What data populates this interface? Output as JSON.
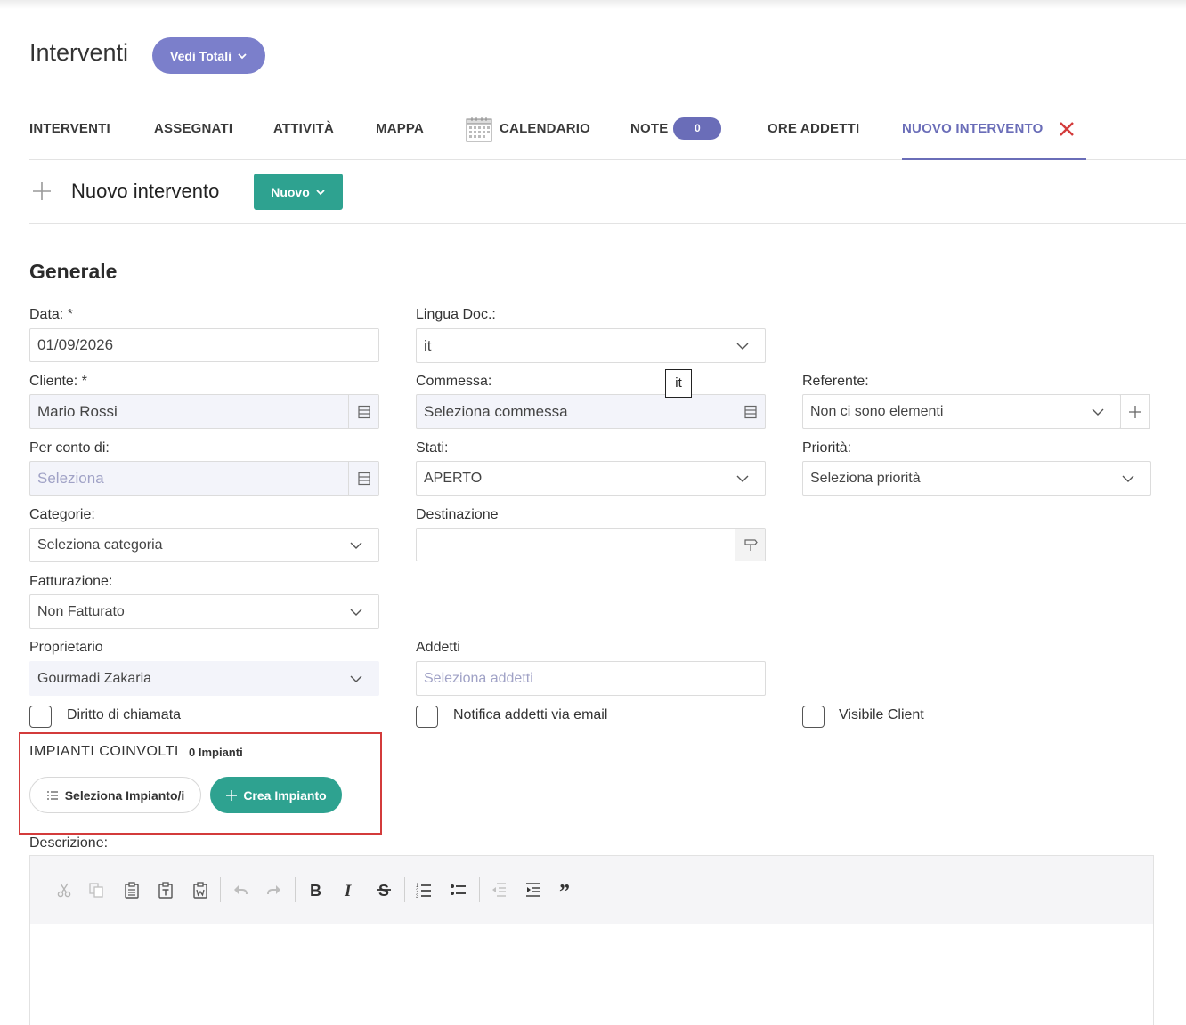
{
  "header": {
    "title": "Interventi",
    "totals_button": "Vedi Totali"
  },
  "tabs": [
    {
      "label": "INTERVENTI"
    },
    {
      "label": "ASSEGNATI"
    },
    {
      "label": "ATTIVITÀ"
    },
    {
      "label": "MAPPA"
    },
    {
      "label": "CALENDARIO"
    },
    {
      "label": "NOTE",
      "badge": "0"
    },
    {
      "label": "ORE ADDETTI"
    },
    {
      "label": "NUOVO INTERVENTO"
    }
  ],
  "section": {
    "title": "Nuovo intervento",
    "new_button": "Nuovo"
  },
  "form": {
    "heading": "Generale",
    "data": {
      "label": "Data: *",
      "value": "01/09/2026"
    },
    "lingua": {
      "label": "Lingua Doc.:",
      "value": "it",
      "tooltip": "it"
    },
    "cliente": {
      "label": "Cliente: *",
      "value": "Mario Rossi"
    },
    "commessa": {
      "label": "Commessa:",
      "value": "Seleziona commessa"
    },
    "referente": {
      "label": "Referente:",
      "value": "Non ci sono elementi"
    },
    "per_conto": {
      "label": "Per conto di:",
      "placeholder": "Seleziona"
    },
    "stati": {
      "label": "Stati:",
      "value": "APERTO"
    },
    "priorita": {
      "label": "Priorità:",
      "value": "Seleziona priorità"
    },
    "categorie": {
      "label": "Categorie:",
      "value": "Seleziona categoria"
    },
    "destinazione": {
      "label": "Destinazione",
      "value": ""
    },
    "fatturazione": {
      "label": "Fatturazione:",
      "value": "Non Fatturato"
    },
    "proprietario": {
      "label": "Proprietario",
      "value": "Gourmadi Zakaria"
    },
    "addetti": {
      "label": "Addetti",
      "placeholder": "Seleziona addetti"
    },
    "checkboxes": {
      "diritto": "Diritto di chiamata",
      "notifica": "Notifica addetti via email",
      "visibile": "Visibile Client"
    }
  },
  "impianti": {
    "title": "IMPIANTI COINVOLTI",
    "count": "0 Impianti",
    "select_button": "Seleziona Impianto/i",
    "create_button": "Crea Impianto"
  },
  "descrizione": {
    "label": "Descrizione:"
  },
  "colors": {
    "accent": "#6a6db8",
    "pill": "#7b7fcb",
    "green": "#2ea290",
    "danger": "#d33b3b"
  }
}
